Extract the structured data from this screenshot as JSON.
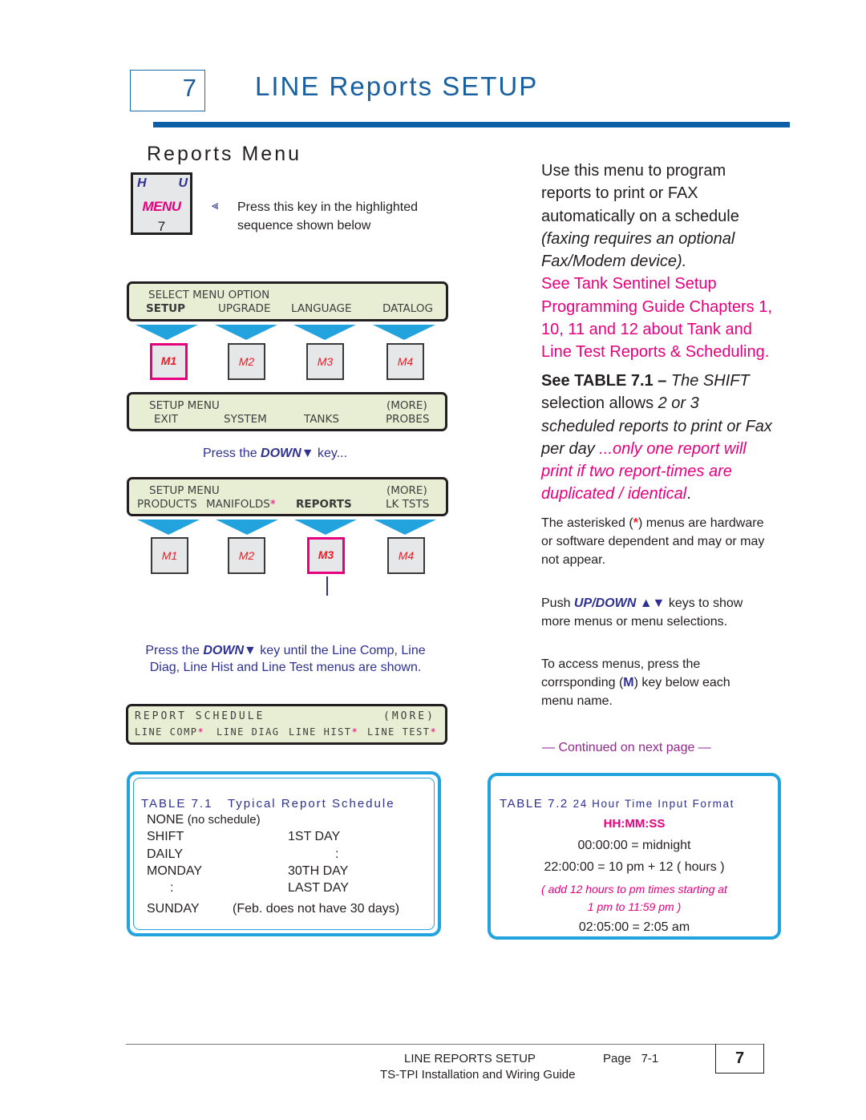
{
  "header": {
    "chapter_number": "7",
    "chapter_title": "LINE Reports SETUP"
  },
  "section_title": "Reports Menu",
  "menu_key": {
    "top_left": "H",
    "top_right": "U",
    "label": "MENU",
    "number": "7"
  },
  "menu_key_note": {
    "line1": "Press this key in the highlighted",
    "line2": "sequence shown below"
  },
  "displays": [
    {
      "line1": "SELECT MENU OPTION",
      "line1_right": "",
      "items": [
        "SETUP",
        "UPGRADE",
        "LANGUAGE",
        "DATALOG"
      ],
      "highlighted_item": 0
    },
    {
      "line1": "SETUP MENU",
      "line1_right": "(MORE)",
      "items": [
        "EXIT",
        "SYSTEM",
        "TANKS",
        "PROBES"
      ]
    },
    {
      "line1": "SETUP MENU",
      "line1_right": "(MORE)",
      "items": [
        "PRODUCTS",
        "MANIFOLDS",
        "REPORTS",
        "LK TSTS"
      ],
      "asterisk_items": [
        1
      ],
      "highlighted_item": 2
    },
    {
      "line1": "REPORT SCHEDULE",
      "line1_right": "(MORE)",
      "items": [
        "LINE COMP",
        "LINE DIAG",
        "LINE HIST",
        "LINE TEST"
      ],
      "asterisk_items": [
        0,
        2,
        3
      ]
    }
  ],
  "asterisk": "*",
  "m_keys": [
    "M1",
    "M2",
    "M3",
    "M4"
  ],
  "highlighted_keys": {
    "row1": "M1",
    "row2": "M3"
  },
  "notes": {
    "press_down_1_pre": "Press the ",
    "down_word": "DOWN",
    "down_glyph": "▼",
    "press_down_1_post": " key...",
    "press_down_2_pre": "Press the ",
    "press_down_2_post": " key until the Line Comp, Line",
    "press_down_2_line2": "Diag, Line Hist and Line Test menus are shown."
  },
  "right_column": {
    "intro_plain": "Use this menu to program reports to print or FAX automatically on a schedule ",
    "intro_italic": "(faxing requires an optional Fax/Modem device).",
    "intro_pink": "See Tank Sentinel Setup Programming Guide Chapters 1, 10, 11 and 12 about Tank and Line Test Reports & Scheduling.",
    "see_bold": "See TABLE 7.1 –",
    "see_italic_1": " The SHIFT",
    "see_plain_1": "selection allows ",
    "see_italic_2": "2 or 3 scheduled reports to print or Fax per day",
    "see_pink": "...only one report will print if two report-times are duplicated / identical",
    "see_end": ".",
    "asterisk_note_pre": "The asterisked (",
    "asterisk_note_post": ") menus are hardware or software dependent and may or may not appear.",
    "push_pre": "Push ",
    "push_keys": "UP/DOWN",
    "push_glyphs": "▲▼",
    "push_post": " keys to show more menus or menu selections.",
    "access_pre": "To access menus, press the corrsponding (",
    "access_key": "M",
    "access_post": ") key below each menu name.",
    "continued": "— Continued on next page —"
  },
  "table_7_1": {
    "number": "TABLE 7.1",
    "title": "Typical Report Schedule",
    "none_label": "NONE",
    "none_note": "(no schedule)",
    "left_column": [
      "SHIFT",
      "DAILY",
      "MONDAY",
      ":",
      "SUNDAY"
    ],
    "right_column": [
      "1ST DAY",
      ":",
      "30TH DAY",
      "LAST DAY",
      "(Feb. does not have 30 days)"
    ]
  },
  "table_7_2": {
    "number": "TABLE 7.2",
    "title": "24 Hour Time Input Format",
    "format": "HH:MM:SS",
    "rows": [
      "00:00:00 = midnight",
      "22:00:00 = 10 pm + 12 ( hours )"
    ],
    "note_line1": "( add 12 hours to pm times starting at",
    "note_line2": "1 pm to 11:59 pm  )",
    "last_row": "02:05:00 = 2:05 am"
  },
  "footer": {
    "section": "LINE REPORTS SETUP",
    "page_label": "Page",
    "page_number": "7-1",
    "guide": "TS-TPI Installation and Wiring Guide",
    "chapter_tab": "7"
  },
  "colors": {
    "title_blue": "#1a5fa0",
    "accent_pink": "#e6007e",
    "note_blue": "#2e3192",
    "arrow_cyan": "#23a3dd",
    "lcd_green": "#e7eed4"
  }
}
